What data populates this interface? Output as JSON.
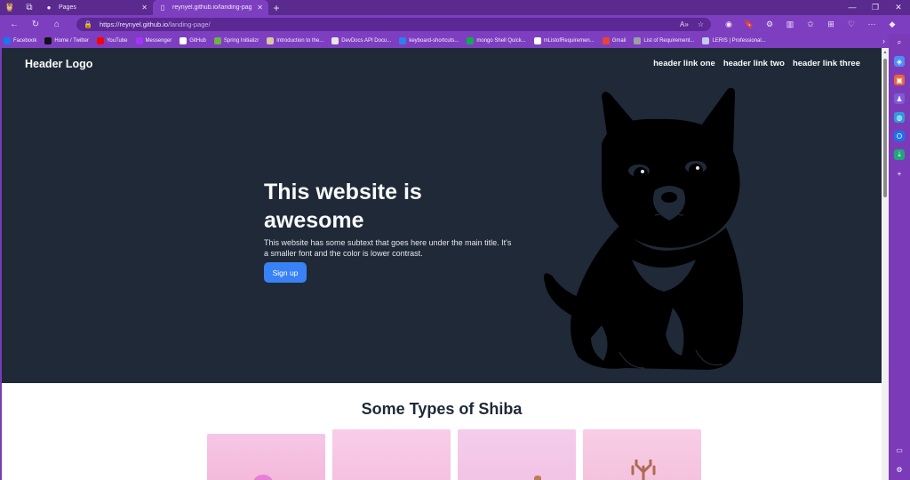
{
  "browser": {
    "tabs": [
      {
        "title": "Pages",
        "active": false,
        "icon": "github-icon"
      },
      {
        "title": "reynyel.github.io/landing-page/",
        "active": true,
        "icon": "page-icon"
      }
    ],
    "url": {
      "host": "https://reynyel.github.io",
      "path": "/landing-page/"
    },
    "bookmarks": [
      {
        "label": "Facebook",
        "color": "#1877f2"
      },
      {
        "label": "Home / Twitter",
        "color": "#111111"
      },
      {
        "label": "YouTube",
        "color": "#ff0000"
      },
      {
        "label": "Messenger",
        "color": "#a334fa"
      },
      {
        "label": "GitHub",
        "color": "#ffffff"
      },
      {
        "label": "Spring Initializr",
        "color": "#6db33f"
      },
      {
        "label": "Introduction to the...",
        "color": "#d9c7a4"
      },
      {
        "label": "DevDocs API Docu...",
        "color": "#e6e6e6"
      },
      {
        "label": "keyboard-shortcuts...",
        "color": "#2f80ed"
      },
      {
        "label": "mongo Shell Quick...",
        "color": "#13aa52"
      },
      {
        "label": "mListofRequiremen...",
        "color": "#ffffff"
      },
      {
        "label": "Gmail",
        "color": "#ea4335"
      },
      {
        "label": "List of Requirement...",
        "color": "#9aa0a6"
      },
      {
        "label": "LERIS | Professional...",
        "color": "#c5cae9"
      }
    ]
  },
  "page": {
    "header": {
      "logo": "Header Logo",
      "links": [
        "header link one",
        "header link two",
        "header link three"
      ]
    },
    "hero": {
      "title": "This website is awesome",
      "subtitle": "This website has some subtext that goes here under the main title. It's a smaller font and the color is lower contrast.",
      "cta": "Sign up",
      "illustration": "shiba-puppy-illustration"
    },
    "types": {
      "title": "Some Types of Shiba"
    }
  },
  "colors": {
    "hero_bg": "#1f2937",
    "hero_text": "#f9fafb",
    "cta_bg": "#3882f6",
    "browser_accent": "#7d3fc0"
  }
}
